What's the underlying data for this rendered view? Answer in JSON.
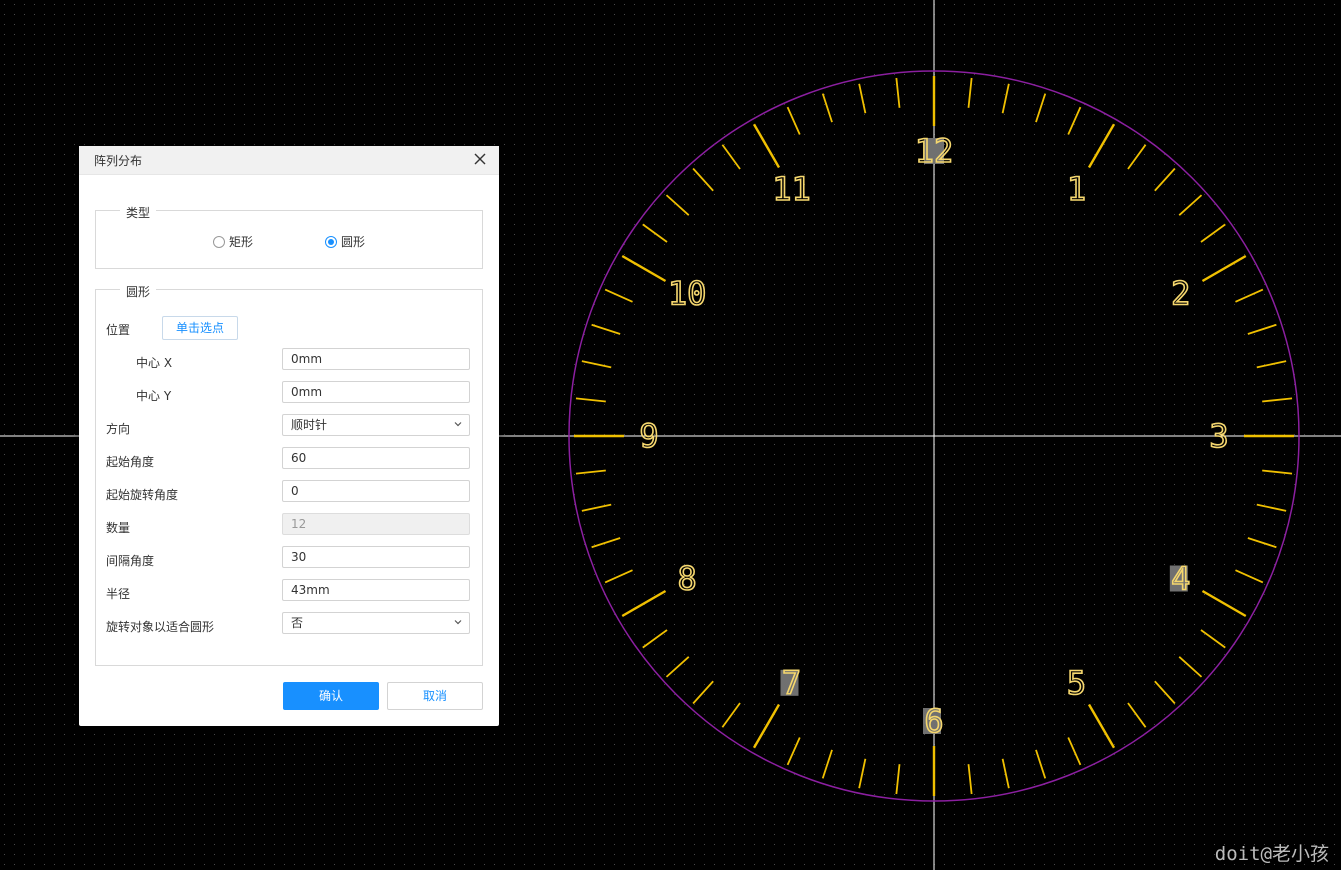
{
  "colors": {
    "background": "#000000",
    "grid_dot": "#3a3a3a",
    "crosshair": "#ffffff",
    "circle_outline": "#8b1fa0",
    "tick": "#f0c000",
    "numeral": "#f5d76e",
    "numeral_highlight": "#707070",
    "accent": "#1890ff"
  },
  "canvas": {
    "clock_numerals": [
      "12",
      "1",
      "2",
      "3",
      "4",
      "5",
      "6",
      "7",
      "8",
      "9",
      "10",
      "11"
    ],
    "highlighted_numerals": [
      "12",
      "4",
      "6",
      "7"
    ],
    "tick_count": 60,
    "long_tick_every": 5
  },
  "dialog": {
    "title": "阵列分布",
    "close_icon": "close-icon",
    "type_group": {
      "legend": "类型",
      "options": [
        {
          "label": "矩形",
          "checked": false
        },
        {
          "label": "圆形",
          "checked": true
        }
      ]
    },
    "circle_group": {
      "legend": "圆形",
      "position_label": "位置",
      "pick_button": "单击选点",
      "center_x_label": "中心 X",
      "center_x_value": "0mm",
      "center_y_label": "中心 Y",
      "center_y_value": "0mm",
      "direction_label": "方向",
      "direction_value": "顺时针",
      "start_angle_label": "起始角度",
      "start_angle_value": "60",
      "start_rotation_label": "起始旋转角度",
      "start_rotation_value": "0",
      "count_label": "数量",
      "count_value": "12",
      "interval_angle_label": "间隔角度",
      "interval_angle_value": "30",
      "radius_label": "半径",
      "radius_value": "43mm",
      "rotate_fit_label": "旋转对象以适合圆形",
      "rotate_fit_value": "否"
    },
    "ok_button": "确认",
    "cancel_button": "取消"
  },
  "watermark": "doit@老小孩"
}
